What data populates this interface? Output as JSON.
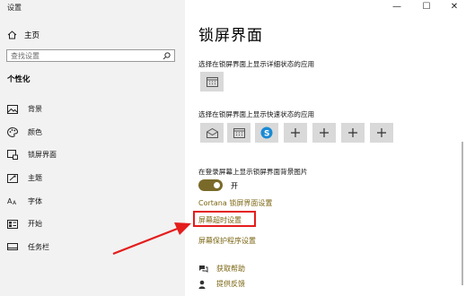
{
  "window": {
    "title": "设置",
    "minimize": "—",
    "maximize": "☐",
    "close": "✕"
  },
  "sidebar": {
    "home_label": "主页",
    "search_placeholder": "查找设置",
    "section_title": "个性化",
    "items": [
      {
        "label": "背景",
        "icon": "image-icon"
      },
      {
        "label": "颜色",
        "icon": "palette-icon"
      },
      {
        "label": "锁屏界面",
        "icon": "lock-screen-icon"
      },
      {
        "label": "主题",
        "icon": "theme-icon"
      },
      {
        "label": "字体",
        "icon": "font-icon"
      },
      {
        "label": "开始",
        "icon": "start-icon"
      },
      {
        "label": "任务栏",
        "icon": "taskbar-icon"
      }
    ]
  },
  "main": {
    "title": "锁屏界面",
    "detail_status_label": "选择在锁屏界面上显示详细状态的应用",
    "quick_status_label": "选择在锁屏界面上显示快速状态的应用",
    "quick_status_tiles": [
      "mail-icon",
      "calendar-icon",
      "skype-icon",
      "add-icon",
      "add-icon",
      "add-icon",
      "add-icon"
    ],
    "signin_bg_label": "在登录屏幕上显示锁屏界面背景图片",
    "toggle_state": "开",
    "toggle_on": true,
    "links": [
      "Cortana 锁屏界面设置",
      "屏幕超时设置",
      "屏幕保护程序设置"
    ],
    "help": [
      "获取帮助",
      "提供反馈"
    ]
  },
  "colors": {
    "accent": "#7a6410",
    "toggle": "#7a6a2a",
    "highlight": "#e41d1d",
    "arrow": "#e41d1d",
    "sidebar_bg": "#f2f2f2"
  }
}
